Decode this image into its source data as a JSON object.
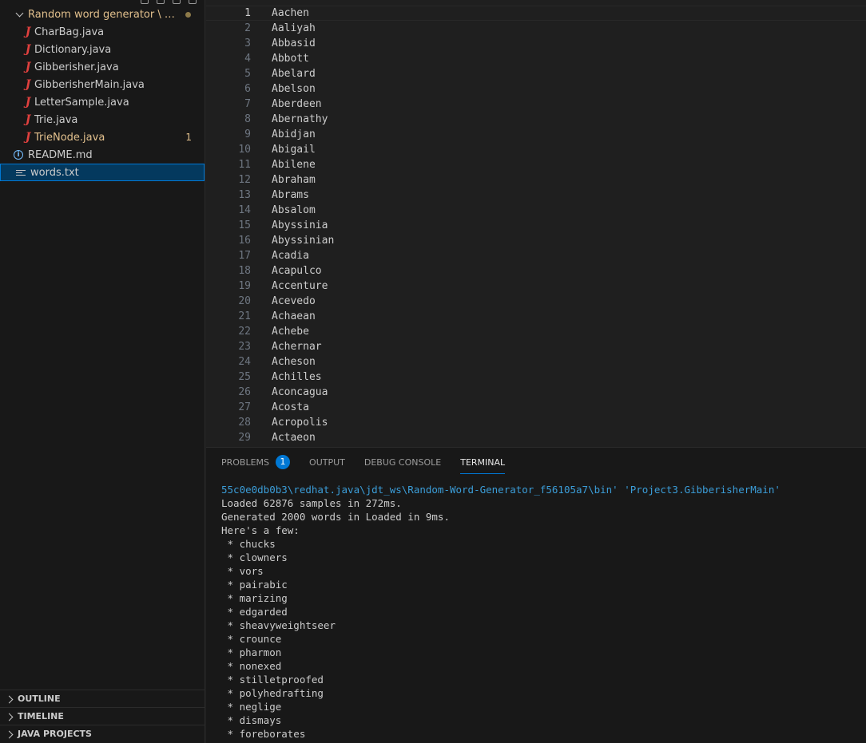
{
  "sidebar": {
    "folder": "Random word generator \\ Proj...",
    "files": [
      {
        "name": "CharBag.java"
      },
      {
        "name": "Dictionary.java"
      },
      {
        "name": "Gibberisher.java"
      },
      {
        "name": "GibberisherMain.java"
      },
      {
        "name": "LetterSample.java"
      },
      {
        "name": "Trie.java"
      },
      {
        "name": "TrieNode.java",
        "count": "1"
      }
    ],
    "readme": "README.md",
    "words": "words.txt",
    "java_icon_glyph": "J",
    "info_icon_glyph": "i",
    "sections": [
      "OUTLINE",
      "TIMELINE",
      "JAVA PROJECTS"
    ]
  },
  "editor": {
    "lines": [
      {
        "n": "1",
        "t": "Aachen"
      },
      {
        "n": "2",
        "t": "Aaliyah"
      },
      {
        "n": "3",
        "t": "Abbasid"
      },
      {
        "n": "4",
        "t": "Abbott"
      },
      {
        "n": "5",
        "t": "Abelard"
      },
      {
        "n": "6",
        "t": "Abelson"
      },
      {
        "n": "7",
        "t": "Aberdeen"
      },
      {
        "n": "8",
        "t": "Abernathy"
      },
      {
        "n": "9",
        "t": "Abidjan"
      },
      {
        "n": "10",
        "t": "Abigail"
      },
      {
        "n": "11",
        "t": "Abilene"
      },
      {
        "n": "12",
        "t": "Abraham"
      },
      {
        "n": "13",
        "t": "Abrams"
      },
      {
        "n": "14",
        "t": "Absalom"
      },
      {
        "n": "15",
        "t": "Abyssinia"
      },
      {
        "n": "16",
        "t": "Abyssinian"
      },
      {
        "n": "17",
        "t": "Acadia"
      },
      {
        "n": "18",
        "t": "Acapulco"
      },
      {
        "n": "19",
        "t": "Accenture"
      },
      {
        "n": "20",
        "t": "Acevedo"
      },
      {
        "n": "21",
        "t": "Achaean"
      },
      {
        "n": "22",
        "t": "Achebe"
      },
      {
        "n": "23",
        "t": "Achernar"
      },
      {
        "n": "24",
        "t": "Acheson"
      },
      {
        "n": "25",
        "t": "Achilles"
      },
      {
        "n": "26",
        "t": "Aconcagua"
      },
      {
        "n": "27",
        "t": "Acosta"
      },
      {
        "n": "28",
        "t": "Acropolis"
      },
      {
        "n": "29",
        "t": "Actaeon"
      }
    ]
  },
  "panel": {
    "tabs": [
      {
        "label": "PROBLEMS",
        "badge": "1"
      },
      {
        "label": "OUTPUT"
      },
      {
        "label": "DEBUG CONSOLE"
      },
      {
        "label": "TERMINAL"
      }
    ],
    "terminal": {
      "path_line": "55c0e0db0b3\\redhat.java\\jdt_ws\\Random-Word-Generator_f56105a7\\bin' 'Project3.GibberisherMain'",
      "lines": [
        "Loaded 62876 samples in 272ms.",
        "Generated 2000 words in Loaded in 9ms.",
        "Here's a few:",
        " * chucks",
        " * clowners",
        " * vors",
        " * pairabic",
        " * marizing",
        " * edgarded",
        " * sheavyweightseer",
        " * crounce",
        " * pharmon",
        " * nonexed",
        " * stilletproofed",
        " * polyhedrafting",
        " * neglige",
        " * dismays",
        " * foreborates"
      ]
    }
  }
}
